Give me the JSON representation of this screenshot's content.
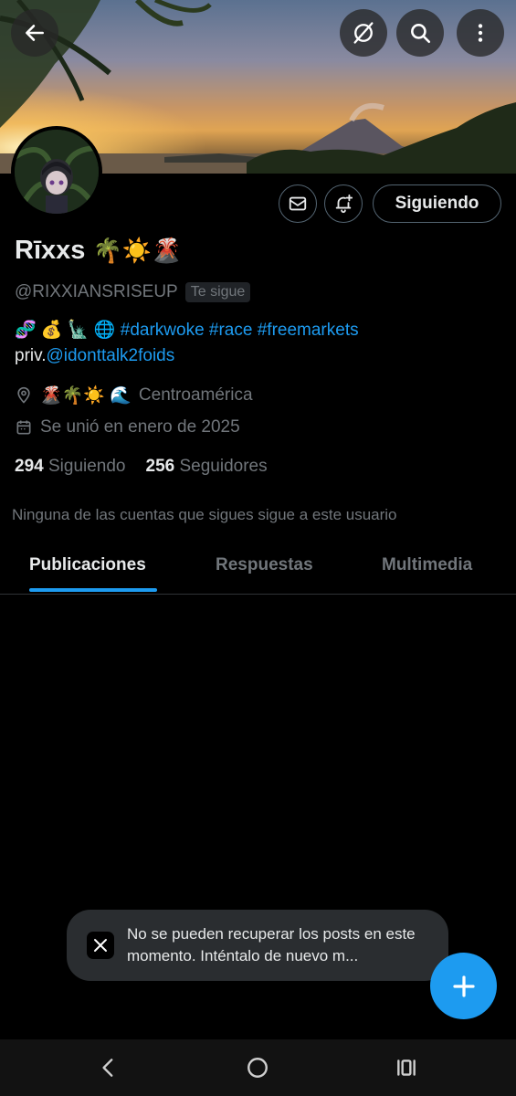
{
  "profile": {
    "name": "Rīxxs",
    "name_emoji": "🌴☀️🌋",
    "handle": "@RIXXIANSRISEUP",
    "follows_you": "Te sigue",
    "bio_emoji": "🧬 💰 🗽 🌐",
    "bio_hashtags": "#darkwoke #race #freemarkets",
    "bio_priv_prefix": "priv.",
    "bio_priv_link": "@idonttalk2foids",
    "location_emoji": "🌋🌴☀️ 🌊",
    "location": "Centroamérica",
    "joined": "Se unió en enero de 2025",
    "following_count": "294",
    "following_label": "Siguiendo",
    "followers_count": "256",
    "followers_label": "Seguidores",
    "mutuals_text": "Ninguna de las cuentas que sigues sigue a este usuario"
  },
  "actions": {
    "following_button": "Siguiendo"
  },
  "tabs": [
    {
      "label": "Publicaciones",
      "active": true
    },
    {
      "label": "Respuestas",
      "active": false
    },
    {
      "label": "Multimedia",
      "active": false
    }
  ],
  "toast": {
    "message": "No se pueden recuperar los posts en este momento. Inténtalo de nuevo m..."
  },
  "colors": {
    "accent": "#1d9bf0",
    "background": "#000000",
    "secondary_text": "#71767b"
  }
}
